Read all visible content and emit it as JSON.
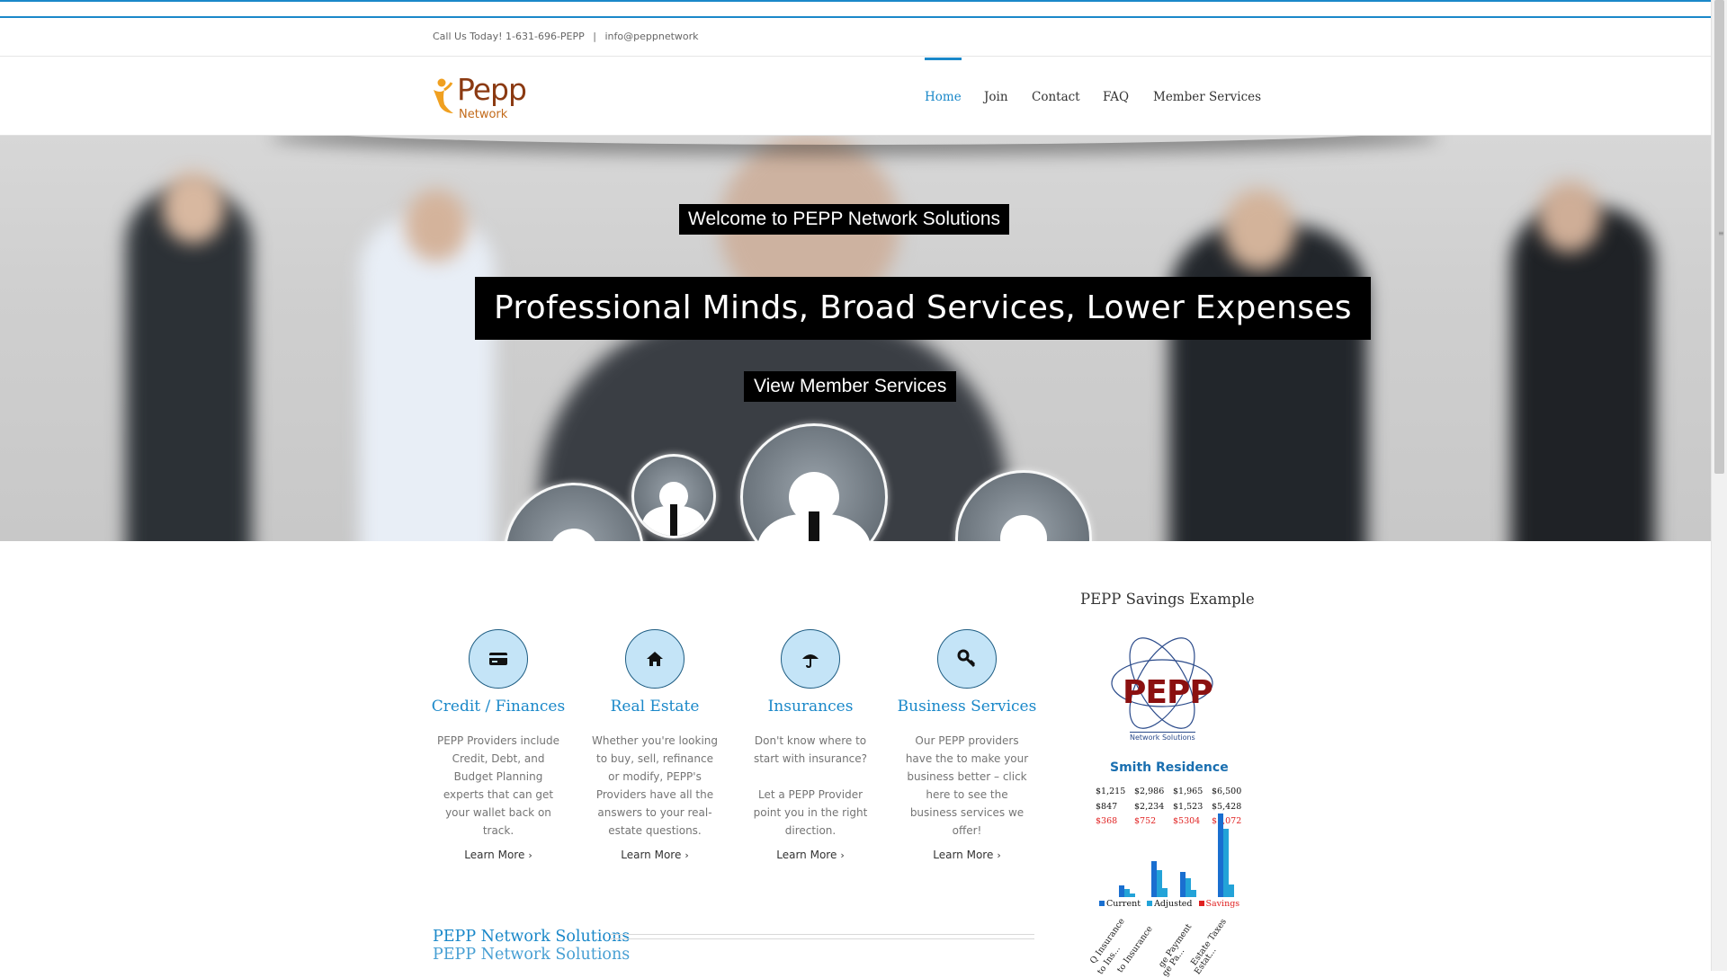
{
  "topbar": {
    "call": "Call Us Today! 1-631-696-PEPP",
    "separator": "|",
    "email": "info@peppnetwork"
  },
  "logo": {
    "name": "Pepp",
    "sub": "Network"
  },
  "nav": {
    "items": [
      {
        "label": "Home",
        "active": true
      },
      {
        "label": "Join"
      },
      {
        "label": "Contact"
      },
      {
        "label": "FAQ"
      },
      {
        "label": "Member Services"
      }
    ]
  },
  "hero": {
    "caption1": "Welcome to PEPP Network Solutions",
    "caption2": "Professional Minds, Broad Services, Lower Expenses",
    "button": "View Member Services"
  },
  "services": [
    {
      "icon": "credit-card-icon",
      "title": "Credit / Finances",
      "desc": "PEPP Providers include Credit, Debt, and Budget Planning experts that can get your wallet back on track.",
      "more": "Learn More"
    },
    {
      "icon": "home-icon",
      "title": "Real Estate",
      "desc": "Whether you're looking to buy, sell, refinance or modify, PEPP's Providers have all the answers to your real-estate questions.",
      "more": "Learn More"
    },
    {
      "icon": "umbrella-icon",
      "title": "Insurances",
      "desc1": "Don't know where to start with insurance?",
      "desc2": "Let a PEPP Provider point you in the right direction.",
      "more": "Learn More"
    },
    {
      "icon": "key-icon",
      "title": "Business Services",
      "desc": "Our PEPP providers have the to make your business better – click here to see the business services we offer!",
      "more": "Learn More"
    }
  ],
  "section": {
    "title": "PEPP Network Solutions"
  },
  "sidebar": {
    "title": "PEPP Savings Example",
    "image": {
      "brand": "PEPP",
      "sub": "Network Solutions",
      "residence": "Smith Residence",
      "rows": [
        [
          "$1,215",
          "$2,986",
          "$1,965",
          "$6,500"
        ],
        [
          "$847",
          "$2,234",
          "$1,523",
          "$5,428"
        ],
        [
          "$368",
          "$752",
          "$5304",
          "$1,072"
        ]
      ],
      "legend": [
        "Current",
        "Adjusted",
        "Savings"
      ],
      "categories": [
        "Q Insurance",
        "to Ins...",
        "to Insurance",
        "ge Payment",
        "ge Pa...",
        "Estate Taxes",
        "Estat..."
      ],
      "colors": {
        "current": "#1a6fd0",
        "adjusted": "#23a3d8",
        "savings": "#e02020"
      }
    }
  }
}
